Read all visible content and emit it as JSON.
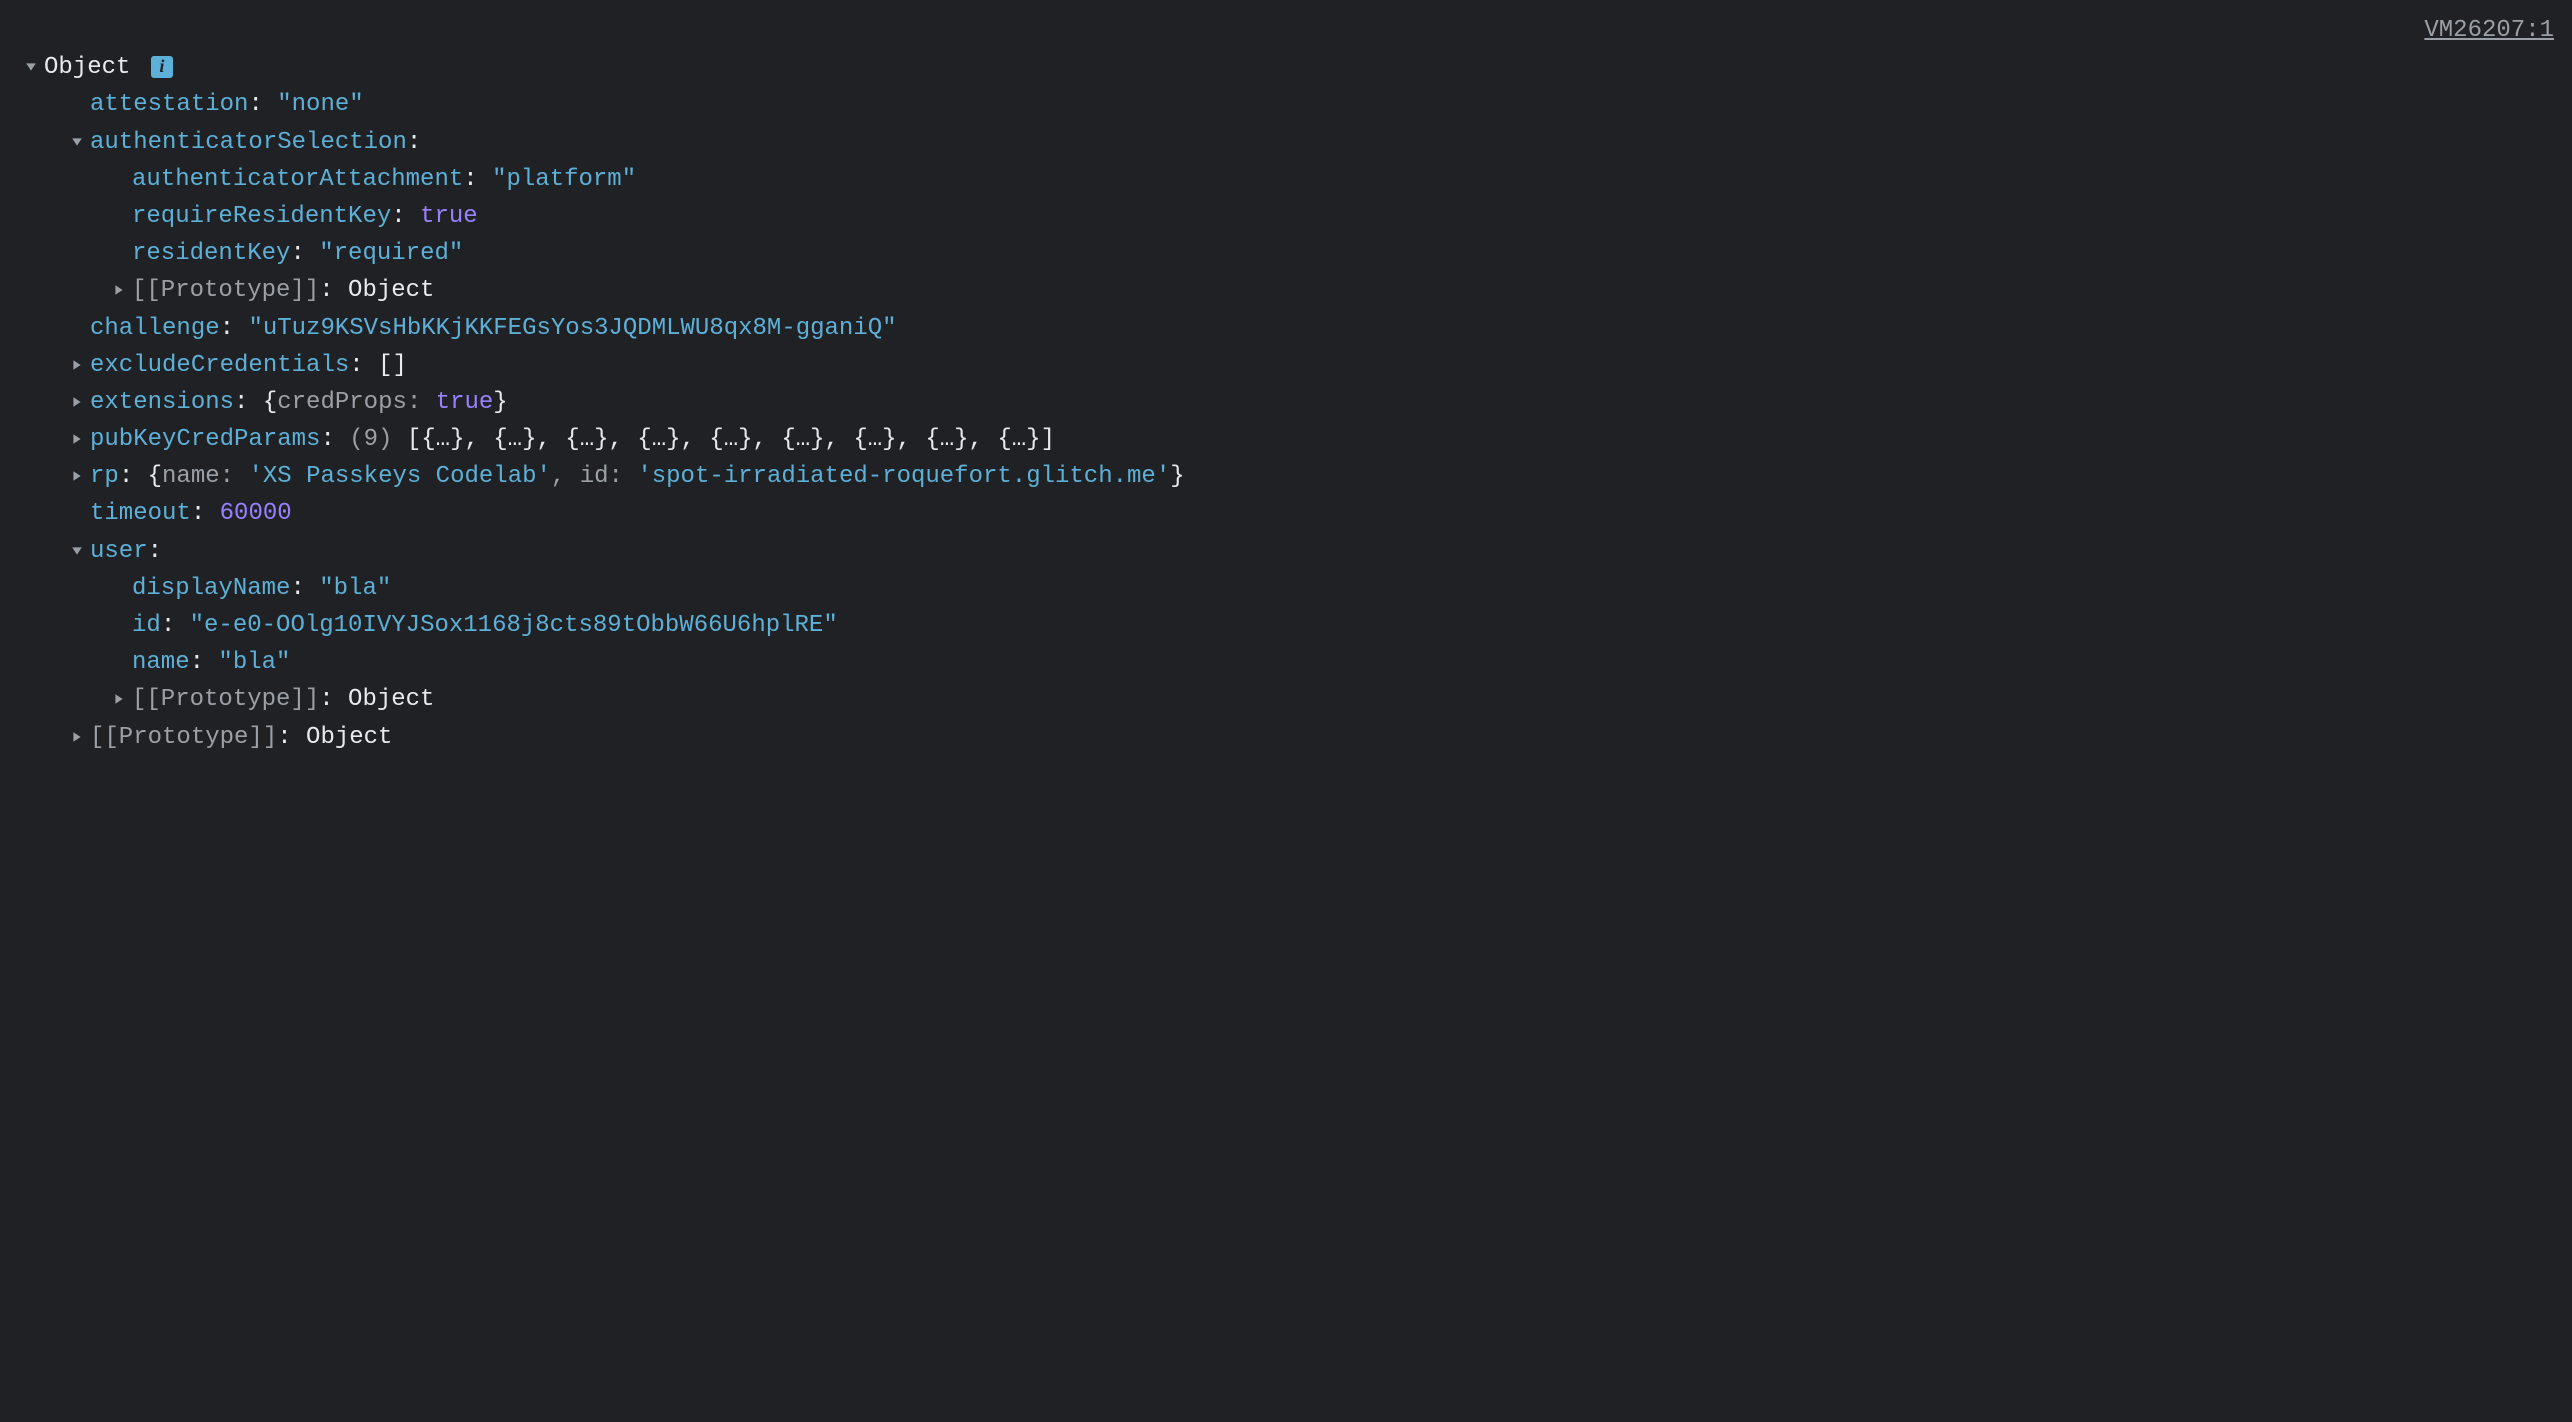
{
  "source_link": "VM26207:1",
  "root_label": "Object",
  "info_badge": "i",
  "props": {
    "attestation_key": "attestation",
    "attestation_val": "\"none\"",
    "authenticatorSelection_key": "authenticatorSelection",
    "authenticatorAttachment_key": "authenticatorAttachment",
    "authenticatorAttachment_val": "\"platform\"",
    "requireResidentKey_key": "requireResidentKey",
    "requireResidentKey_val": "true",
    "residentKey_key": "residentKey",
    "residentKey_val": "\"required\"",
    "proto_key": "[[Prototype]]",
    "proto_val": "Object",
    "challenge_key": "challenge",
    "challenge_val": "\"uTuz9KSVsHbKKjKKFEGsYos3JQDMLWU8qx8M-gganiQ\"",
    "excludeCredentials_key": "excludeCredentials",
    "excludeCredentials_val": "[]",
    "extensions_key": "extensions",
    "extensions_preview_open": "{",
    "extensions_preview_key": "credProps: ",
    "extensions_preview_val": "true",
    "extensions_preview_close": "}",
    "pubKeyCredParams_key": "pubKeyCredParams",
    "pubKeyCredParams_count": "(9) ",
    "pubKeyCredParams_preview": "[{…}, {…}, {…}, {…}, {…}, {…}, {…}, {…}, {…}]",
    "rp_key": "rp",
    "rp_preview_open": "{",
    "rp_preview_name_k": "name: ",
    "rp_preview_name_v": "'XS Passkeys Codelab'",
    "rp_preview_sep": ", ",
    "rp_preview_id_k": "id: ",
    "rp_preview_id_v": "'spot-irradiated-roquefort.glitch.me'",
    "rp_preview_close": "}",
    "timeout_key": "timeout",
    "timeout_val": "60000",
    "user_key": "user",
    "displayName_key": "displayName",
    "displayName_val": "\"bla\"",
    "id_key": "id",
    "id_val": "\"e-e0-OOlg10IVYJSox1168j8cts89tObbW66U6hplRE\"",
    "name_key": "name",
    "name_val": "\"bla\""
  }
}
